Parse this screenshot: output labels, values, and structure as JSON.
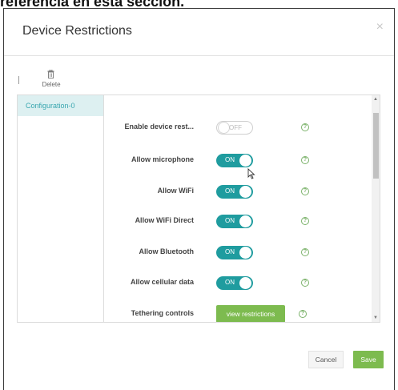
{
  "caption": "referencia en esta sección.",
  "dialog": {
    "title": "Device Restrictions",
    "close_icon": "×"
  },
  "toolbar": {
    "delete_label": "Delete"
  },
  "configurations": [
    {
      "label": "Configuration-0",
      "selected": true
    }
  ],
  "settings": [
    {
      "label": "Enable device rest...",
      "control": "toggle",
      "state": "OFF"
    },
    {
      "label": "Allow microphone",
      "control": "toggle",
      "state": "ON"
    },
    {
      "label": "Allow WiFi",
      "control": "toggle",
      "state": "ON"
    },
    {
      "label": "Allow WiFi Direct",
      "control": "toggle",
      "state": "ON"
    },
    {
      "label": "Allow Bluetooth",
      "control": "toggle",
      "state": "ON"
    },
    {
      "label": "Allow cellular data",
      "control": "toggle",
      "state": "ON"
    },
    {
      "label": "Tethering controls",
      "control": "button",
      "button_label": "view restrictions"
    }
  ],
  "help_icon": "?",
  "footer": {
    "cancel_label": "Cancel",
    "save_label": "Save"
  },
  "colors": {
    "toggle_on": "#1f9c9f",
    "primary_button": "#7dbb4f",
    "selected_item_bg": "#ddf0f1",
    "selected_item_text": "#3aa7b0"
  }
}
